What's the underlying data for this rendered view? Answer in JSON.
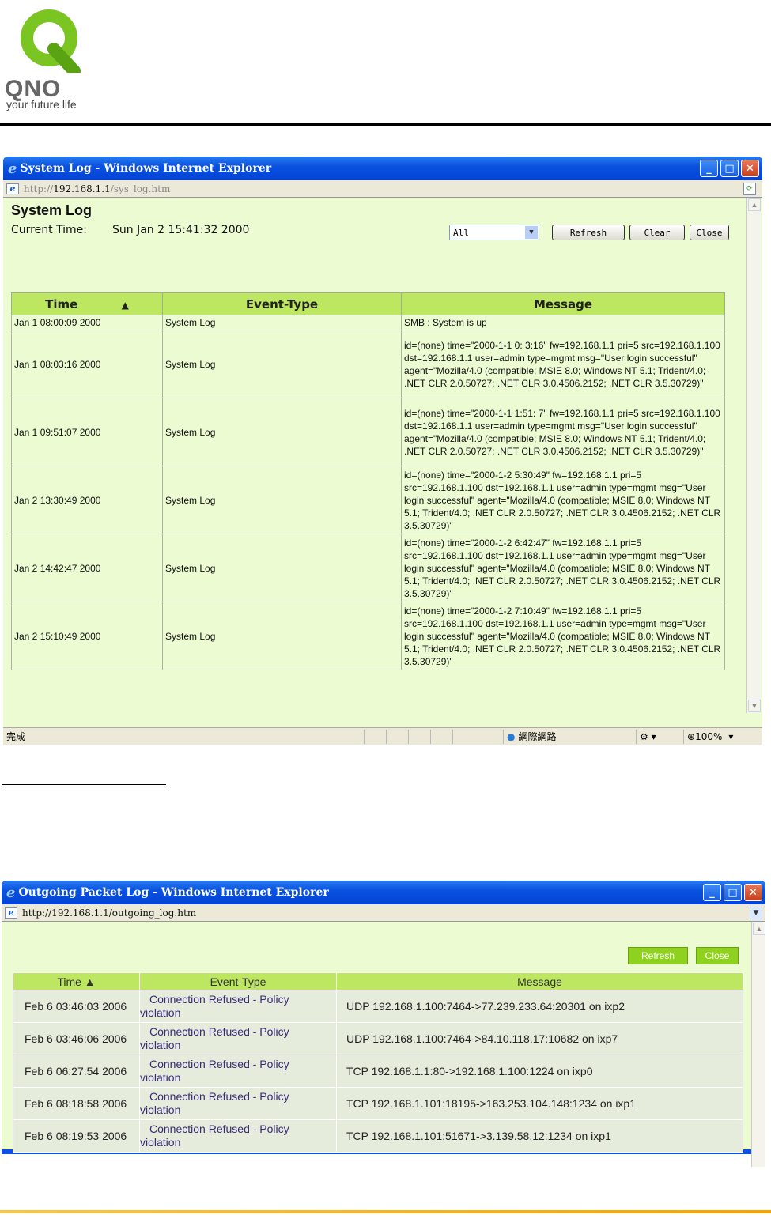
{
  "logo": {
    "wordmark": "QNO",
    "tagline": "your future life"
  },
  "window1": {
    "title": "System Log - Windows Internet Explorer",
    "url_prefix": "http://",
    "url_host": "192.168.1.1",
    "url_path": "/sys_log.htm",
    "page_title": "System Log",
    "current_time_label": "Current Time:",
    "current_time_value": "Sun Jan 2 15:41:32 2000",
    "filter_value": "All",
    "refresh_label": "Refresh",
    "clear_label": "Clear",
    "close_label": "Close",
    "columns": {
      "time": "Time",
      "sort_indicator": "▲",
      "event_type": "Event-Type",
      "message": "Message"
    },
    "rows": [
      {
        "time": "Jan 1 08:00:09 2000",
        "event": "System Log",
        "message": "SMB : System is up"
      },
      {
        "time": "Jan 1 08:03:16 2000",
        "event": "System Log",
        "message": "id=(none) time=\"2000-1-1 0: 3:16\" fw=192.168.1.1 pri=5 src=192.168.1.100 dst=192.168.1.1 user=admin type=mgmt msg=\"User login successful\" agent=\"Mozilla/4.0 (compatible; MSIE 8.0; Windows NT 5.1; Trident/4.0; .NET CLR 2.0.50727; .NET CLR 3.0.4506.2152; .NET CLR 3.5.30729)\""
      },
      {
        "time": "Jan 1 09:51:07 2000",
        "event": "System Log",
        "message": "id=(none) time=\"2000-1-1 1:51: 7\" fw=192.168.1.1 pri=5 src=192.168.1.100 dst=192.168.1.1 user=admin type=mgmt msg=\"User login successful\" agent=\"Mozilla/4.0 (compatible; MSIE 8.0; Windows NT 5.1; Trident/4.0; .NET CLR 2.0.50727; .NET CLR 3.0.4506.2152; .NET CLR 3.5.30729)\""
      },
      {
        "time": "Jan 2 13:30:49 2000",
        "event": "System Log",
        "message": "id=(none) time=\"2000-1-2 5:30:49\" fw=192.168.1.1 pri=5 src=192.168.1.100 dst=192.168.1.1 user=admin type=mgmt msg=\"User login successful\" agent=\"Mozilla/4.0 (compatible; MSIE 8.0; Windows NT 5.1; Trident/4.0; .NET CLR 2.0.50727; .NET CLR 3.0.4506.2152; .NET CLR 3.5.30729)\""
      },
      {
        "time": "Jan 2 14:42:47 2000",
        "event": "System Log",
        "message": "id=(none) time=\"2000-1-2 6:42:47\" fw=192.168.1.1 pri=5 src=192.168.1.100 dst=192.168.1.1 user=admin type=mgmt msg=\"User login successful\" agent=\"Mozilla/4.0 (compatible; MSIE 8.0; Windows NT 5.1; Trident/4.0; .NET CLR 2.0.50727; .NET CLR 3.0.4506.2152; .NET CLR 3.5.30729)\""
      },
      {
        "time": "Jan 2 15:10:49 2000",
        "event": "System Log",
        "message": "id=(none) time=\"2000-1-2 7:10:49\" fw=192.168.1.1 pri=5 src=192.168.1.100 dst=192.168.1.1 user=admin type=mgmt msg=\"User login successful\" agent=\"Mozilla/4.0 (compatible; MSIE 8.0; Windows NT 5.1; Trident/4.0; .NET CLR 2.0.50727; .NET CLR 3.0.4506.2152; .NET CLR 3.5.30729)\""
      }
    ],
    "status": {
      "left": "完成",
      "zone": "網際網路",
      "zoom": "100%"
    }
  },
  "window2": {
    "title": "Outgoing Packet Log - Windows Internet Explorer",
    "url": "http://192.168.1.1/outgoing_log.htm",
    "refresh_label": "Refresh",
    "close_label": "Close",
    "columns": {
      "time": "Time ▲",
      "event_type": "Event-Type",
      "message": "Message"
    },
    "rows": [
      {
        "time": "Feb 6 03:46:03 2006",
        "event_1": "Connection Refused - Policy",
        "event_2": "violation",
        "message": "UDP 192.168.1.100:7464->77.239.233.64:20301 on ixp2"
      },
      {
        "time": "Feb 6 03:46:06 2006",
        "event_1": "Connection Refused - Policy",
        "event_2": "violation",
        "message": "UDP 192.168.1.100:7464->84.10.118.17:10682 on ixp7"
      },
      {
        "time": "Feb 6 06:27:54 2006",
        "event_1": "Connection Refused - Policy",
        "event_2": "violation",
        "message": "TCP 192.168.1.1:80->192.168.1.100:1224 on ixp0"
      },
      {
        "time": "Feb 6 08:18:58 2006",
        "event_1": "Connection Refused - Policy",
        "event_2": "violation",
        "message": "TCP 192.168.1.101:18195->163.253.104.148:1234 on ixp1"
      },
      {
        "time": "Feb 6 08:19:53 2006",
        "event_1": "Connection Refused - Policy",
        "event_2": "violation",
        "message": "TCP 192.168.1.101:51671->3.139.58.12:1234 on ixp1"
      }
    ]
  }
}
